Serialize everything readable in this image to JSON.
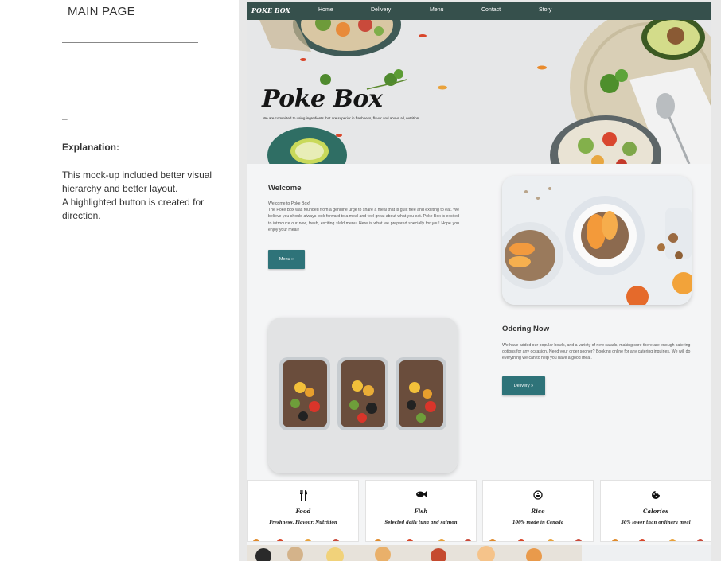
{
  "notes": {
    "page_title": "MAIN PAGE",
    "dash": "–",
    "explanation_heading": "Explanation:",
    "explanation_line1": "This mock-up included better visual hierarchy and better layout.",
    "explanation_line2": "A highlighted button is created for direction."
  },
  "site": {
    "logo": "POKE BOX",
    "nav": [
      "Home",
      "Delivery",
      "Menu",
      "Contact",
      "Story"
    ],
    "hero": {
      "title": "Poke Box",
      "tagline": "We are committed to using ingredients that are superior in freshness, flavor and above all, nutrition."
    },
    "welcome": {
      "heading": "Welcome",
      "intro": "Welcome to Poke Box!",
      "body": "The Poke Box was founded from a genuine urge to share a meal that is guilt free and exciting to eat. We believe you should always look forward to a meal and feel great about what you eat. Poke Box is excited to introduce our new, fresh, exciting slald menu. Here is what we prepared specially for you! Hope you enjoy your meal !",
      "button": "Menu »"
    },
    "ordering": {
      "heading": "Odering Now",
      "body": "We have added our popular bowls, and a variety of new salads, making sure there are enough catering options for any occasion. Need your order sooner? Booking online for any catering inquiries. We will do everything we can to help you have a good meal.",
      "button": "Delivery »"
    },
    "cards": [
      {
        "title": "Food",
        "desc": "Freshness, Flavour, Nutrition",
        "icon": "utensils-icon"
      },
      {
        "title": "Fish",
        "desc": "Selected daily tuna and salmon",
        "icon": "fish-icon"
      },
      {
        "title": "Rice",
        "desc": "100% made in Canada",
        "icon": "rice-icon"
      },
      {
        "title": "Calories",
        "desc": "30% lower than ordinary meal",
        "icon": "cookie-icon"
      }
    ]
  },
  "colors": {
    "nav_bg": "#36504c",
    "button_bg": "#2e7379",
    "mock_bg": "#e8e8e8",
    "section_bg": "#f4f5f6"
  }
}
